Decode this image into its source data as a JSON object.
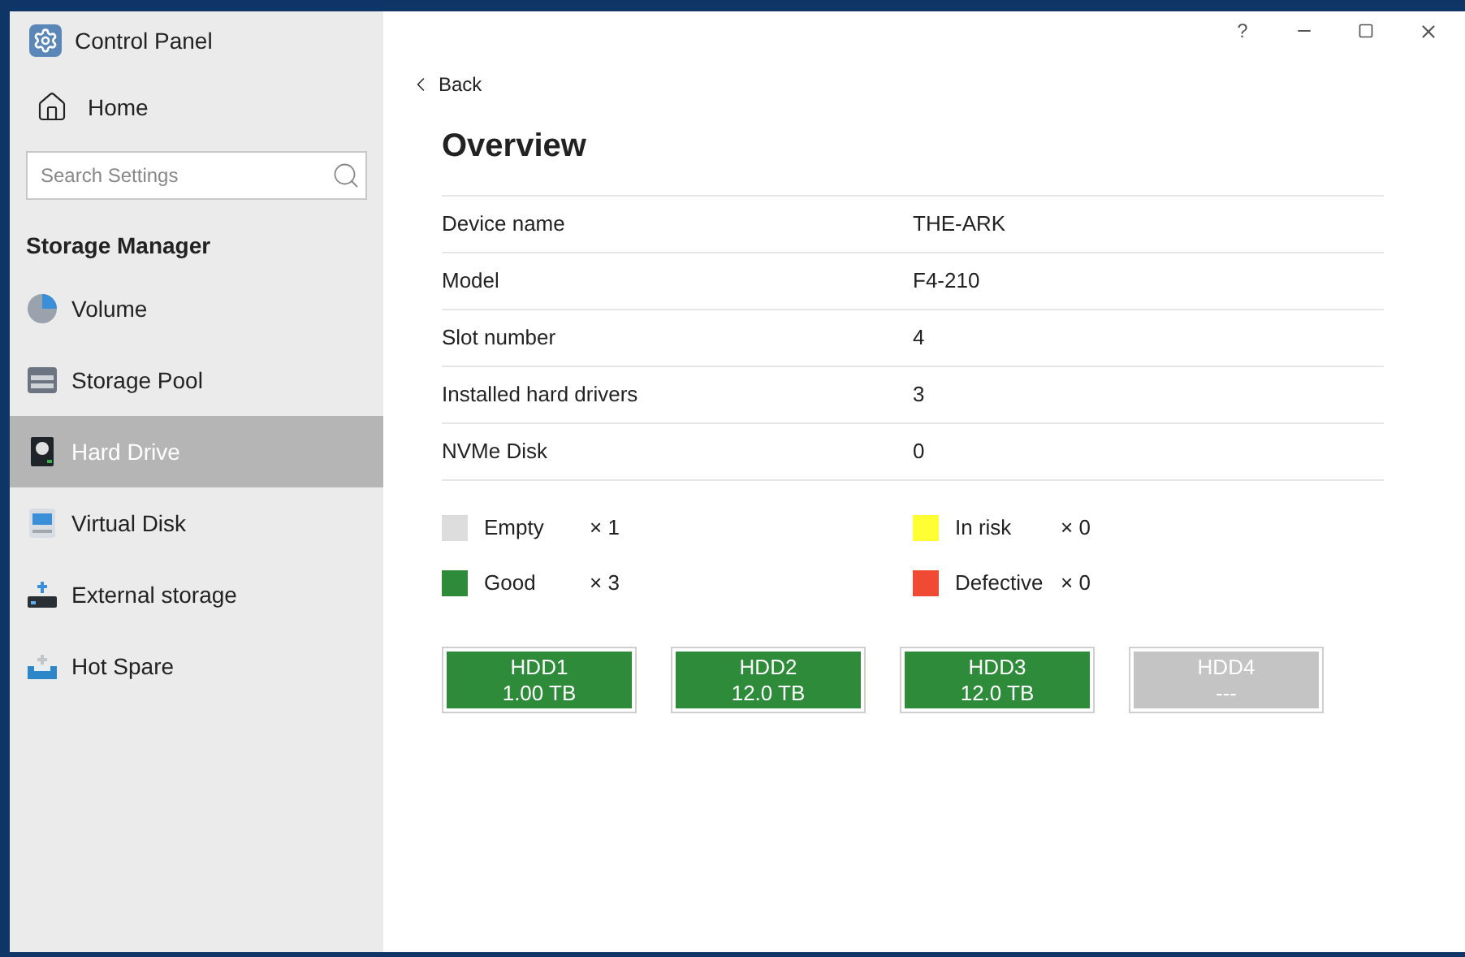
{
  "sidebar": {
    "app_title": "Control Panel",
    "home": "Home",
    "search": {
      "placeholder": "Search Settings"
    },
    "section": "Storage Manager",
    "items": [
      {
        "label": "Volume",
        "kind": "volume",
        "selected": false
      },
      {
        "label": "Storage Pool",
        "kind": "pool",
        "selected": false
      },
      {
        "label": "Hard Drive",
        "kind": "drive",
        "selected": true
      },
      {
        "label": "Virtual Disk",
        "kind": "virtual",
        "selected": false
      },
      {
        "label": "External storage",
        "kind": "external",
        "selected": false
      },
      {
        "label": "Hot Spare",
        "kind": "spare",
        "selected": false
      }
    ]
  },
  "window_controls": {
    "help": "?"
  },
  "back": "Back",
  "title": "Overview",
  "details": [
    {
      "label": "Device name",
      "value": "THE-ARK"
    },
    {
      "label": "Model",
      "value": "F4-210"
    },
    {
      "label": "Slot number",
      "value": "4"
    },
    {
      "label": "Installed hard drivers",
      "value": "3"
    },
    {
      "label": "NVMe Disk",
      "value": "0"
    }
  ],
  "legend": [
    {
      "label": "Empty",
      "count": "× 1",
      "color": "#dddddd"
    },
    {
      "label": "In risk",
      "count": "× 0",
      "color": "#ffff33"
    },
    {
      "label": "Good",
      "count": "× 3",
      "color": "#2e8b3a"
    },
    {
      "label": "Defective",
      "count": "× 0",
      "color": "#f04a35"
    }
  ],
  "disks": [
    {
      "name": "HDD1",
      "size": "1.00 TB",
      "color": "#2e8b3a"
    },
    {
      "name": "HDD2",
      "size": "12.0 TB",
      "color": "#2e8b3a"
    },
    {
      "name": "HDD3",
      "size": "12.0 TB",
      "color": "#2e8b3a"
    },
    {
      "name": "HDD4",
      "size": "---",
      "color": "#c4c4c4"
    }
  ]
}
